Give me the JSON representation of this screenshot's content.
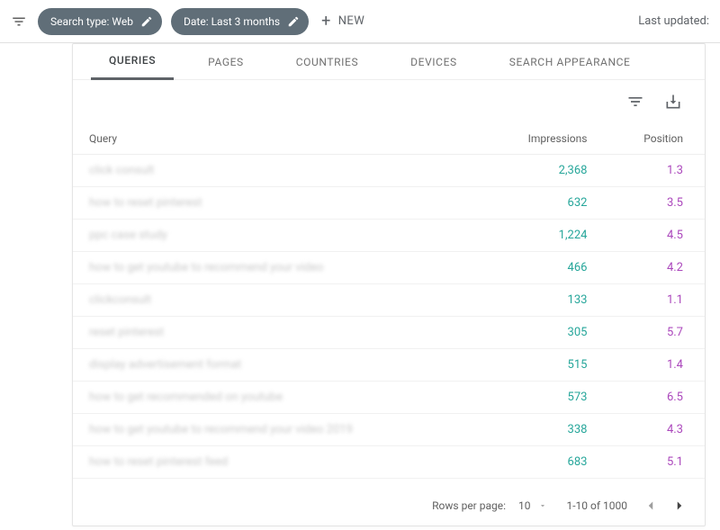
{
  "topbar": {
    "chips": [
      {
        "label": "Search type: Web"
      },
      {
        "label": "Date: Last 3 months"
      }
    ],
    "new_label": "NEW",
    "last_updated": "Last updated:"
  },
  "tabs": [
    {
      "label": "QUERIES",
      "active": true
    },
    {
      "label": "PAGES",
      "active": false
    },
    {
      "label": "COUNTRIES",
      "active": false
    },
    {
      "label": "DEVICES",
      "active": false
    },
    {
      "label": "SEARCH APPEARANCE",
      "active": false
    }
  ],
  "headers": {
    "query": "Query",
    "impressions": "Impressions",
    "position": "Position"
  },
  "rows": [
    {
      "query": "click consult",
      "impressions": "2,368",
      "position": "1.3"
    },
    {
      "query": "how to reset pinterest",
      "impressions": "632",
      "position": "3.5"
    },
    {
      "query": "ppc case study",
      "impressions": "1,224",
      "position": "4.5"
    },
    {
      "query": "how to get youtube to recommend your video",
      "impressions": "466",
      "position": "4.2"
    },
    {
      "query": "clickconsult",
      "impressions": "133",
      "position": "1.1"
    },
    {
      "query": "reset pinterest",
      "impressions": "305",
      "position": "5.7"
    },
    {
      "query": "display advertisement format",
      "impressions": "515",
      "position": "1.4"
    },
    {
      "query": "how to get recommended on youtube",
      "impressions": "573",
      "position": "6.5"
    },
    {
      "query": "how to get youtube to recommend your video 2019",
      "impressions": "338",
      "position": "4.3"
    },
    {
      "query": "how to reset pinterest feed",
      "impressions": "683",
      "position": "5.1"
    }
  ],
  "footer": {
    "rows_label": "Rows per page:",
    "page_size": "10",
    "range": "1-10 of 1000"
  }
}
